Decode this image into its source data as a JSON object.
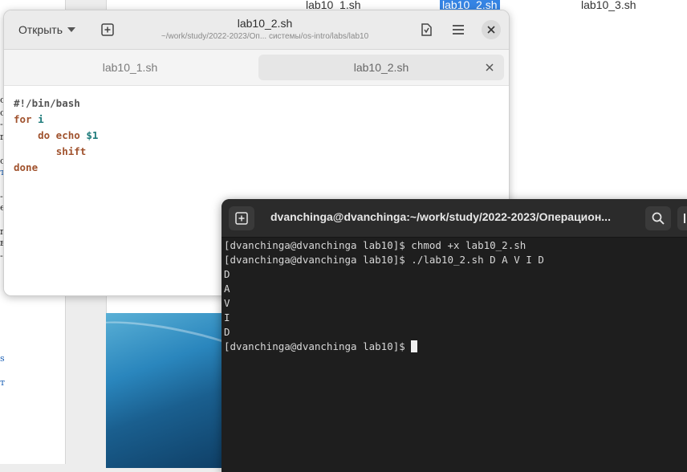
{
  "background_files": {
    "items": [
      "lab10_1.sh",
      "lab10_2.sh",
      "lab10_3.sh"
    ],
    "selected": "lab10_2.sh"
  },
  "gedit": {
    "open_label": "Открыть",
    "title": "lab10_2.sh",
    "subtitle": "~/work/study/2022-2023/Оп... системы/os-intro/labs/lab10",
    "tabs": [
      {
        "label": "lab10_1.sh"
      },
      {
        "label": "lab10_2.sh"
      }
    ],
    "active_tab": "lab10_2.sh",
    "code": {
      "line1": "#!/bin/bash",
      "line2_kw": "for",
      "line2_var": "i",
      "line3_kw": "do echo",
      "line3_var": "$1",
      "line4_kw": "shift",
      "line5_kw": "done"
    },
    "icons": [
      "chevron-down-icon",
      "new-tab-icon",
      "save-icon",
      "hamburger-menu-icon",
      "close-icon"
    ]
  },
  "terminal": {
    "title": "dvanchinga@dvanchinga:~/work/study/2022-2023/Операцион...",
    "lines": [
      "[dvanchinga@dvanchinga lab10]$ chmod +x lab10_2.sh",
      "[dvanchinga@dvanchinga lab10]$ ./lab10_2.sh D A V I D",
      "D",
      "A",
      "V",
      "I",
      "D"
    ],
    "prompt": "[dvanchinga@dvanchinga lab10]$ ",
    "icons": [
      "new-tab-icon",
      "search-icon",
      "menu-icon"
    ]
  },
  "colors": {
    "selection": "#3584e4",
    "terminal_bg": "#1e1e1e",
    "keyword": "#a0522d",
    "variable": "#1c7a7a"
  }
}
